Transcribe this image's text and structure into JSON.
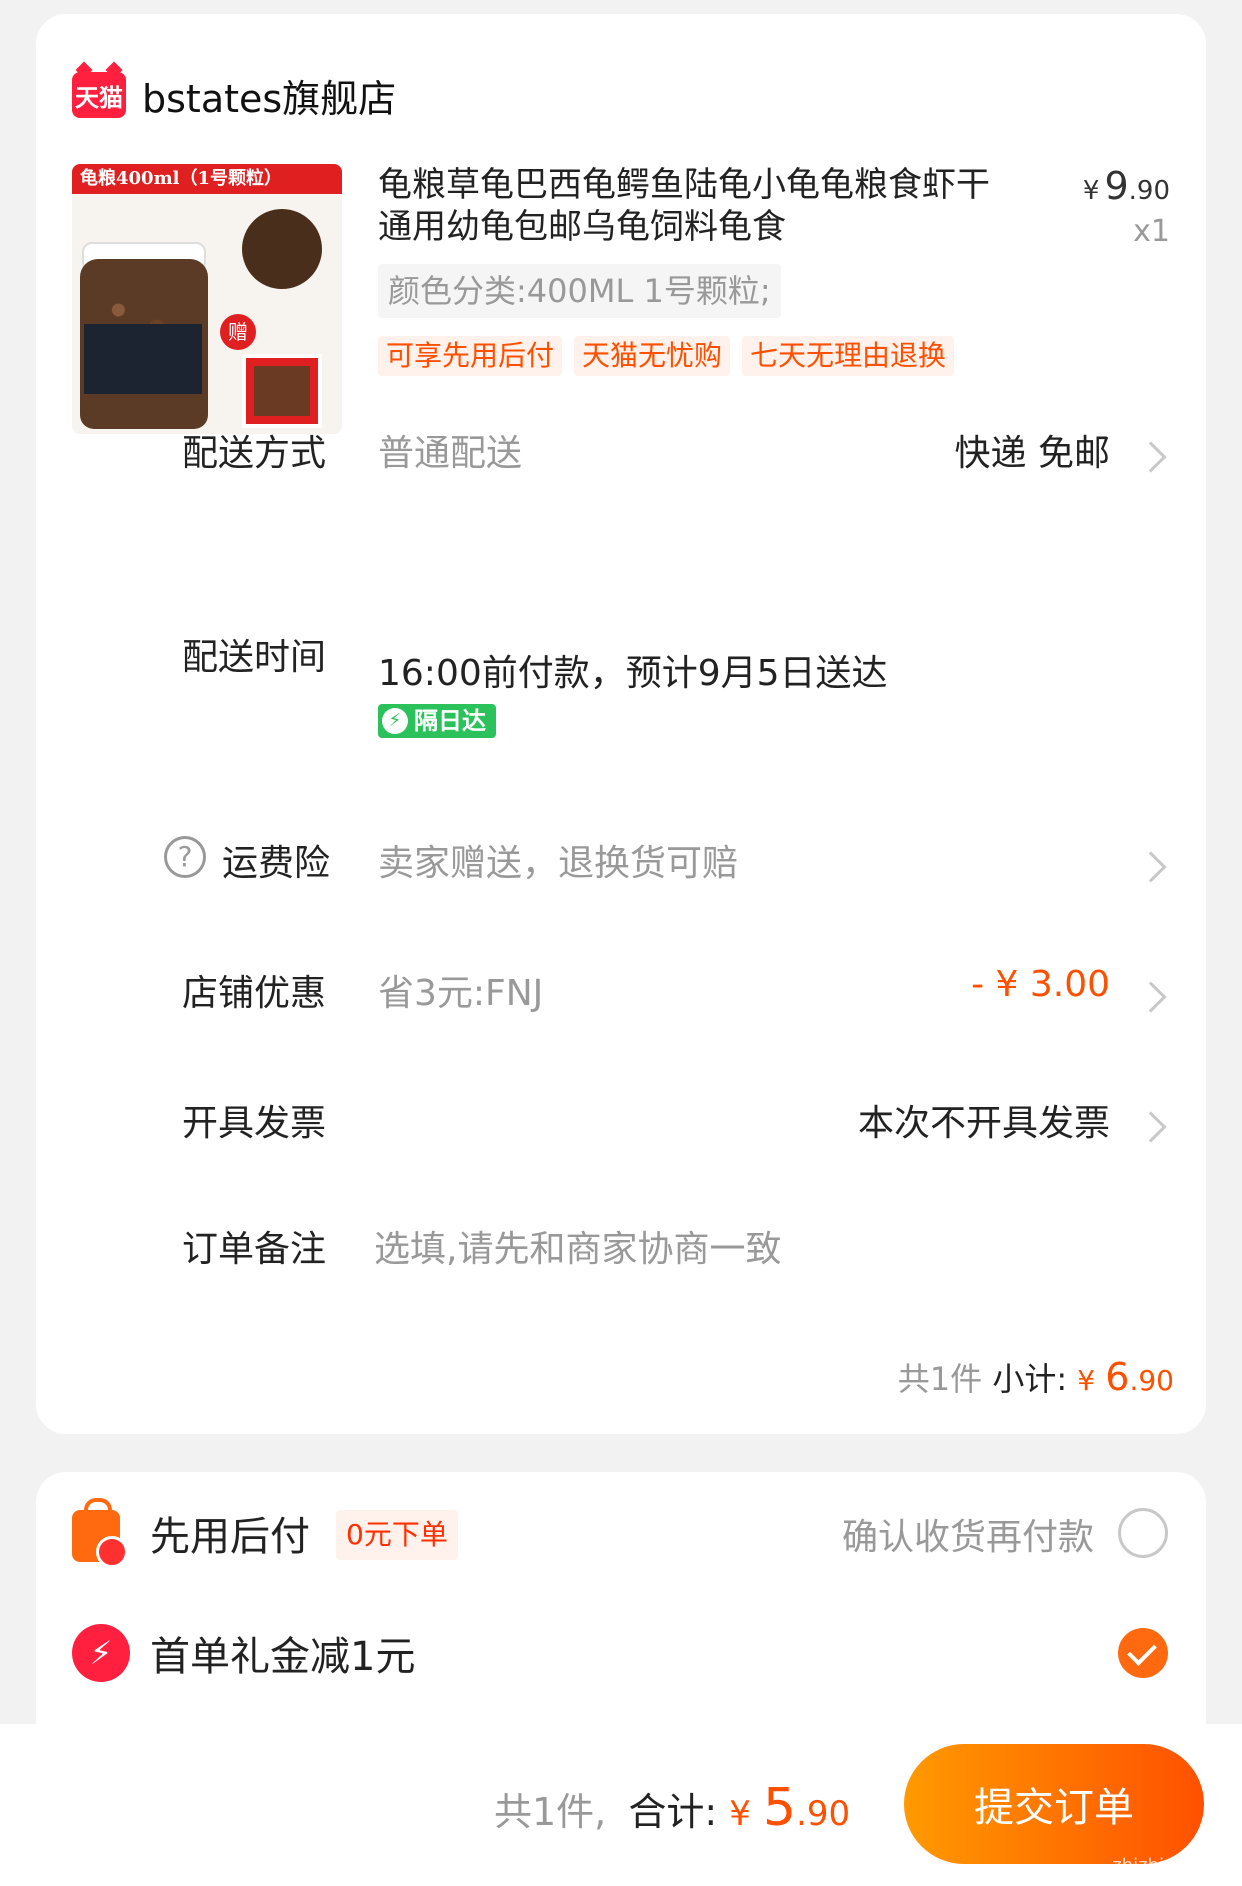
{
  "store": {
    "badge": "天猫",
    "name": "bstates旗舰店"
  },
  "product": {
    "image_banner": "龟粮400ml（1号颗粒）",
    "image_gift_tag": "赠",
    "title": "龟粮草龟巴西龟鳄鱼陆龟小龟龟粮食虾干通用幼龟包邮乌龟饲料龟食",
    "price_yen": "¥",
    "price_int": "9",
    "price_dec": ".90",
    "quantity": "x1",
    "sku": "颜色分类:400ML  1号颗粒;",
    "tags": [
      "可享先用后付",
      "天猫无忧购",
      "七天无理由退换"
    ]
  },
  "delivery": {
    "label": "配送方式",
    "value": "普通配送",
    "right": "快递 免邮"
  },
  "delivery_time": {
    "label": "配送时间",
    "value": "16:00前付款，预计9月5日送达",
    "badge": "隔日达"
  },
  "freight_insurance": {
    "help_icon": "?",
    "label": "运费险",
    "value": "卖家赠送，退换货可赔"
  },
  "store_discount": {
    "label": "店铺优惠",
    "value": "省3元:FNJ",
    "right": "- ¥ 3.00",
    "right_color": "#ff5000"
  },
  "invoice": {
    "label": "开具发票",
    "right": "本次不开具发票"
  },
  "remark": {
    "label": "订单备注",
    "placeholder": "选填,请先和商家协商一致"
  },
  "subtotal": {
    "count": "共1件",
    "label": "小计:",
    "yen": "¥",
    "int": "6",
    "dec": ".90"
  },
  "pay_later": {
    "icon": "shopping-bag-icon",
    "label": "先用后付",
    "badge": "0元下单",
    "hint": "确认收货再付款",
    "selected": false
  },
  "first_order": {
    "icon": "lightning-icon",
    "label": "首单礼金减1元",
    "selected": true
  },
  "footer": {
    "count": "共1件,",
    "label": "合计:",
    "yen": "¥",
    "int": "5",
    "dec": ".90",
    "submit": "提交订单",
    "watermark": "zhizhizhi.com"
  },
  "colors": {
    "accent": "#ff5000",
    "brand_red": "#ff1f3f",
    "next_day_green": "#2bc25c"
  }
}
